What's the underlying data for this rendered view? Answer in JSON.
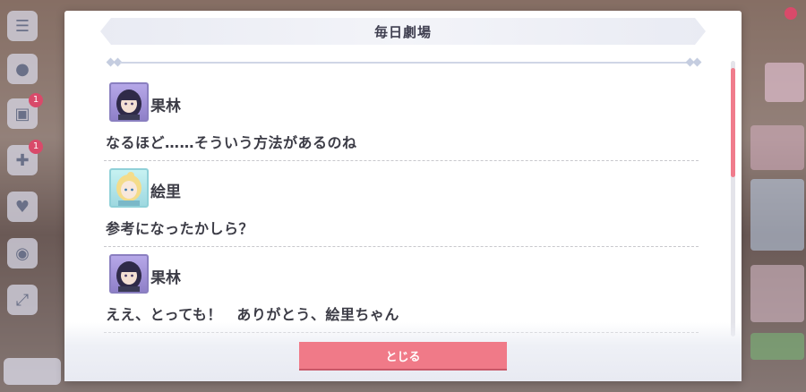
{
  "dialog": {
    "title": "毎日劇場",
    "close_label": "とじる"
  },
  "entries": [
    {
      "speaker": "果林",
      "avatar": "karin",
      "line": "なるほど……そういう方法があるのね"
    },
    {
      "speaker": "絵里",
      "avatar": "eli",
      "line": "参考になったかしら？"
    },
    {
      "speaker": "果林",
      "avatar": "karin",
      "line": "ええ、とっても！　ありがとう、絵里ちゃん"
    }
  ],
  "background": {
    "left_badges": [
      "1",
      "1"
    ]
  },
  "colors": {
    "accent": "#f07a88",
    "scroll_thumb": "#f07c8c",
    "title_text": "#3f3f50"
  },
  "scroll": {
    "position_fraction": 0.0
  }
}
